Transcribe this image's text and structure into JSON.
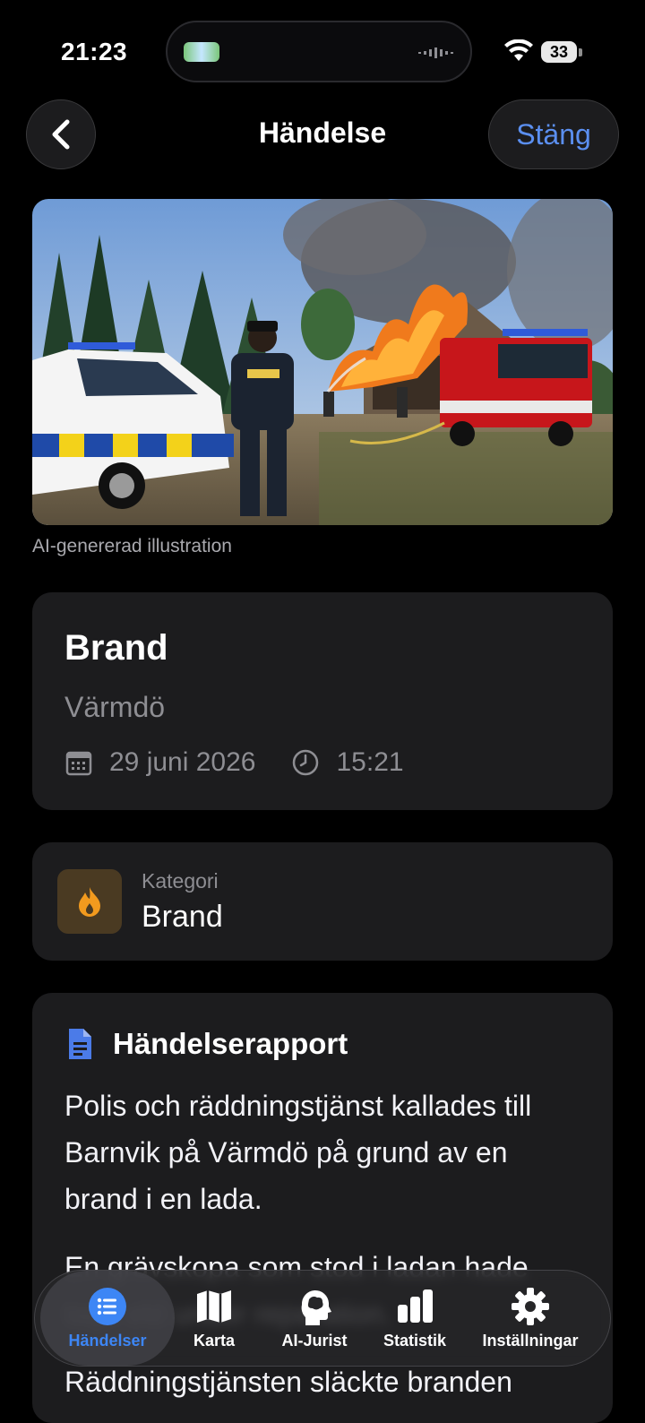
{
  "status_bar": {
    "time": "21:23",
    "battery": "33"
  },
  "nav": {
    "title": "Händelse",
    "close_label": "Stäng"
  },
  "image": {
    "caption": "AI-genererad illustration"
  },
  "event": {
    "title": "Brand",
    "location": "Värmdö",
    "date": "29 juni 2026",
    "time": "15:21"
  },
  "category": {
    "label": "Kategori",
    "value": "Brand"
  },
  "report": {
    "title": "Händelserapport",
    "paragraphs": [
      "Polis och räddningstjänst kallades till Barnvik på Värmdö på grund av en brand i en lada.",
      "En grävskopa som stod i ladan hade tagit eld under reparation.",
      "Räddningstjänsten släckte branden"
    ]
  },
  "tabs": [
    {
      "label": "Händelser",
      "icon": "list-icon",
      "active": true
    },
    {
      "label": "Karta",
      "icon": "map-icon",
      "active": false
    },
    {
      "label": "AI-Jurist",
      "icon": "brain-head-icon",
      "active": false
    },
    {
      "label": "Statistik",
      "icon": "bar-chart-icon",
      "active": false
    },
    {
      "label": "Inställningar",
      "icon": "gear-icon",
      "active": false
    }
  ],
  "colors": {
    "accent": "#3d86f5",
    "close_text": "#5b8ff0",
    "card": "#1c1c1e",
    "category_icon_bg": "#4a3a22",
    "report_icon": "#4b7be8"
  }
}
